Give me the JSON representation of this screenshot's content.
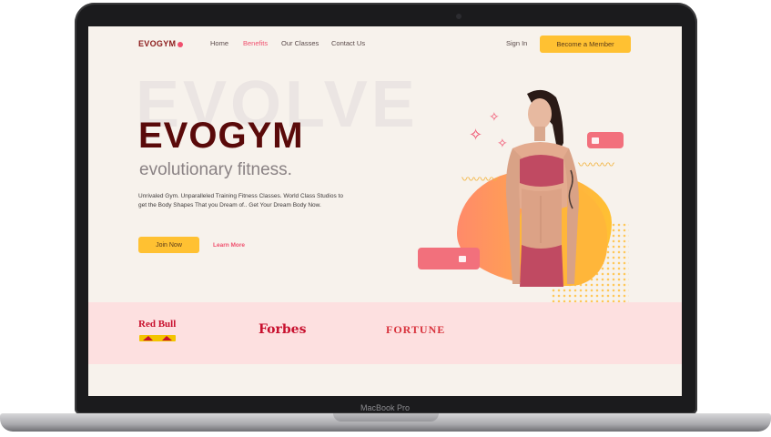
{
  "device": {
    "model_label": "MacBook Pro"
  },
  "nav": {
    "logo": "EVOGYM",
    "links": [
      {
        "label": "Home",
        "active": false
      },
      {
        "label": "Benefits",
        "active": true
      },
      {
        "label": "Our Classes",
        "active": false
      },
      {
        "label": "Contact Us",
        "active": false
      }
    ],
    "signin": "Sign In",
    "cta": "Become a Member"
  },
  "hero": {
    "bg_word": "EVOLVE",
    "title": "EVOGYM",
    "subtitle": "evolutionary fitness.",
    "description": "Unrivaled Gym. Unparalleled Training Fitness Classes. World Class Studios to get the Body Shapes That you Dream of.. Get Your Dream Body Now.",
    "join_label": "Join Now",
    "learn_label": "Learn More"
  },
  "sponsors": {
    "redbull": "Red Bull",
    "forbes": "Forbes",
    "fortune": "FORTUNE"
  },
  "colors": {
    "accent_pink": "#f0506e",
    "accent_yellow": "#ffc132",
    "title_dark_red": "#5a0a0a",
    "sponsor_band": "#fde0e0",
    "background": "#f7f2ec"
  }
}
